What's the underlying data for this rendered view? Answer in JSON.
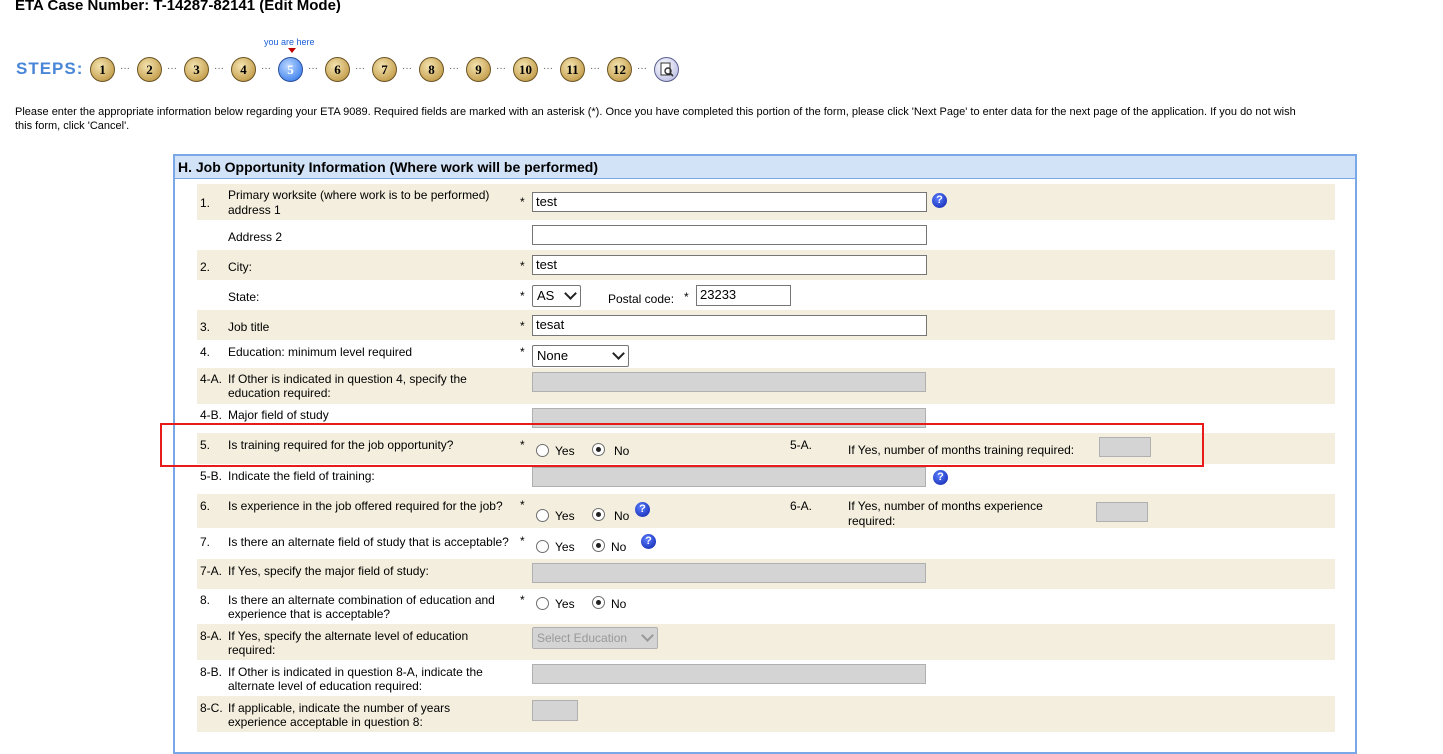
{
  "header": {
    "case_title": "ETA Case Number:  T-14287-82141  (Edit Mode)"
  },
  "steps": {
    "label": "STEPS:",
    "you_are_here": "you are here",
    "current": "5",
    "items": [
      "1",
      "2",
      "3",
      "4",
      "5",
      "6",
      "7",
      "8",
      "9",
      "10",
      "11",
      "12"
    ],
    "review_icon": "magnifier-document-icon"
  },
  "instructions": {
    "line1": "Please enter the appropriate information below regarding your ETA 9089. Required fields are marked with an asterisk (*). Once you have completed this portion of the form, please click 'Next Page' to enter data for the next page of the application. If you do not wish",
    "line2": "this form, click 'Cancel'."
  },
  "section": {
    "title": "H. Job Opportunity Information (Where work will be performed)"
  },
  "form": {
    "q1": {
      "num": "1.",
      "label_l1": "Primary worksite (where work is to be performed)",
      "label_l2": "address 1",
      "value": "test"
    },
    "addr2": {
      "label": "Address 2",
      "value": ""
    },
    "q2": {
      "num": "2.",
      "label": "City:",
      "value": "test"
    },
    "state": {
      "label": "State:",
      "value": "AS",
      "postal_label": "Postal code:",
      "postal_value": "23233"
    },
    "q3": {
      "num": "3.",
      "label": "Job title",
      "value": "tesat"
    },
    "q4": {
      "num": "4.",
      "label": "Education: minimum level required",
      "value": "None"
    },
    "q4a": {
      "num": "4-A.",
      "label_l1": "If Other is indicated in question 4, specify the",
      "label_l2": "education required:"
    },
    "q4b": {
      "num": "4-B.",
      "label": "Major field of study"
    },
    "q5": {
      "num": "5.",
      "label": "Is training required for the job opportunity?",
      "yes": "Yes",
      "no": "No",
      "selected": "No",
      "sub_num": "5-A.",
      "sub_label": "If Yes, number of months training required:"
    },
    "q5b": {
      "num": "5-B.",
      "label": "Indicate the field of training:"
    },
    "q6": {
      "num": "6.",
      "label": "Is experience in the job offered required for the job?",
      "yes": "Yes",
      "no": "No",
      "selected": "No",
      "sub_num": "6-A.",
      "sub_label_l1": "If Yes, number of months experience",
      "sub_label_l2": "required:"
    },
    "q7": {
      "num": "7.",
      "label": "Is there an alternate field of study that is acceptable?",
      "yes": "Yes",
      "no": "No",
      "selected": "No"
    },
    "q7a": {
      "num": "7-A.",
      "label": "If Yes, specify the major field of study:"
    },
    "q8": {
      "num": "8.",
      "label_l1": "Is there an alternate combination of education and",
      "label_l2": "experience that is acceptable?",
      "yes": "Yes",
      "no": "No",
      "selected": "No"
    },
    "q8a": {
      "num": "8-A.",
      "label_l1": "If Yes, specify the alternate level of education",
      "label_l2": "required:",
      "placeholder": "Select Education"
    },
    "q8b": {
      "num": "8-B.",
      "label_l1": "If Other is indicated in question 8-A, indicate the",
      "label_l2": "alternate level of education required:"
    },
    "q8c": {
      "num": "8-C.",
      "label_l1": "If applicable, indicate the number of years",
      "label_l2": "experience acceptable in question 8:"
    },
    "asterisk": "*",
    "help_glyph": "?"
  },
  "colors": {
    "panel_border": "#7aa7e8",
    "panel_header_bg": "#d2e3f8",
    "row_shade": "#f3eedd",
    "highlight": "#e81b1b",
    "steps_label": "#4a86d8"
  }
}
